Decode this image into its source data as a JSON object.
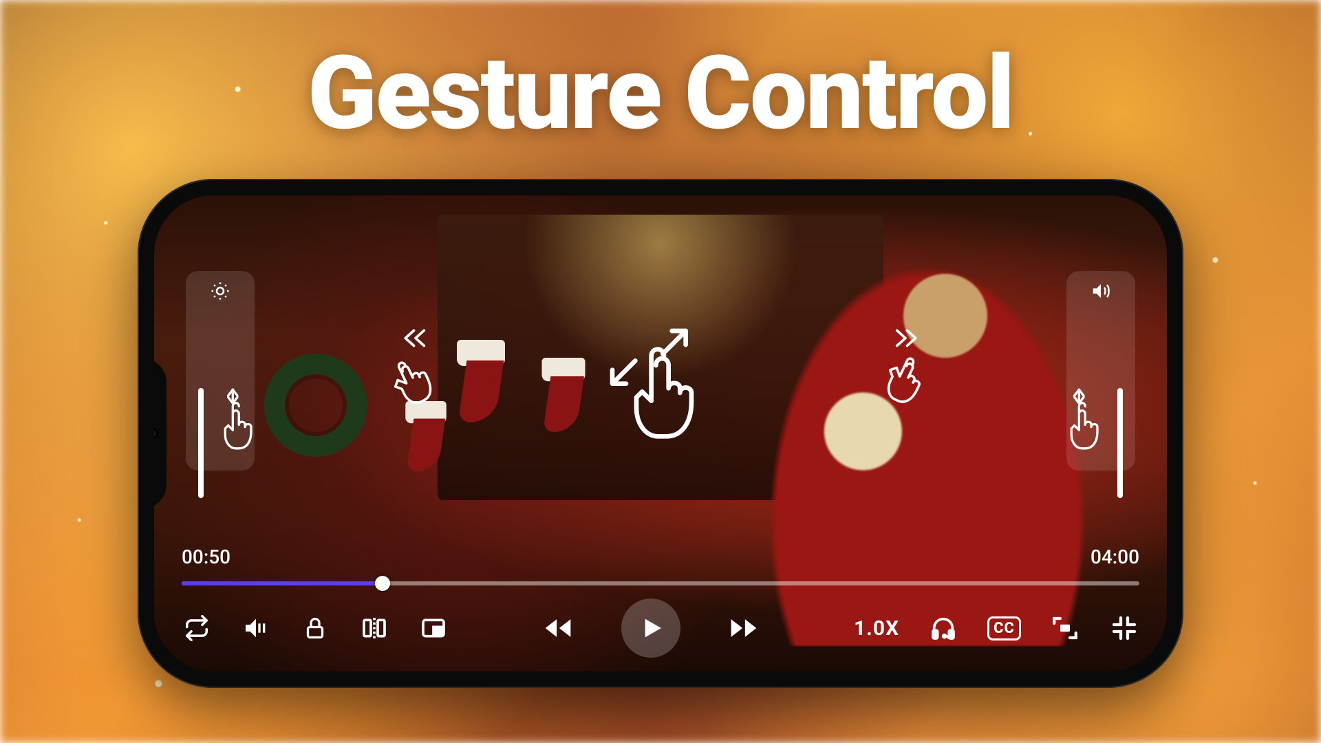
{
  "title": "Gesture Control",
  "player": {
    "current_time": "00:50",
    "total_time": "04:00",
    "progress_pct": 21,
    "speed_label": "1.0X",
    "cc_label": "CC"
  },
  "gestures": {
    "left_panel_icon": "brightness-icon",
    "right_panel_icon": "volume-icon",
    "center": "pinch-zoom",
    "swipe_left": "seek-backward",
    "swipe_right": "seek-forward"
  },
  "icons": {
    "loop": "loop-icon",
    "mute": "volume-icon",
    "lock": "lock-icon",
    "mirror": "mirror-icon",
    "pip": "pip-icon",
    "rewind": "rewind-icon",
    "play": "play-icon",
    "forward": "forward-icon",
    "headphones": "audio-track-icon",
    "aspect": "aspect-ratio-icon",
    "fullscreen_exit": "fullscreen-exit-icon"
  },
  "colors": {
    "accent": "#5b3df5",
    "text": "#ffffff"
  }
}
